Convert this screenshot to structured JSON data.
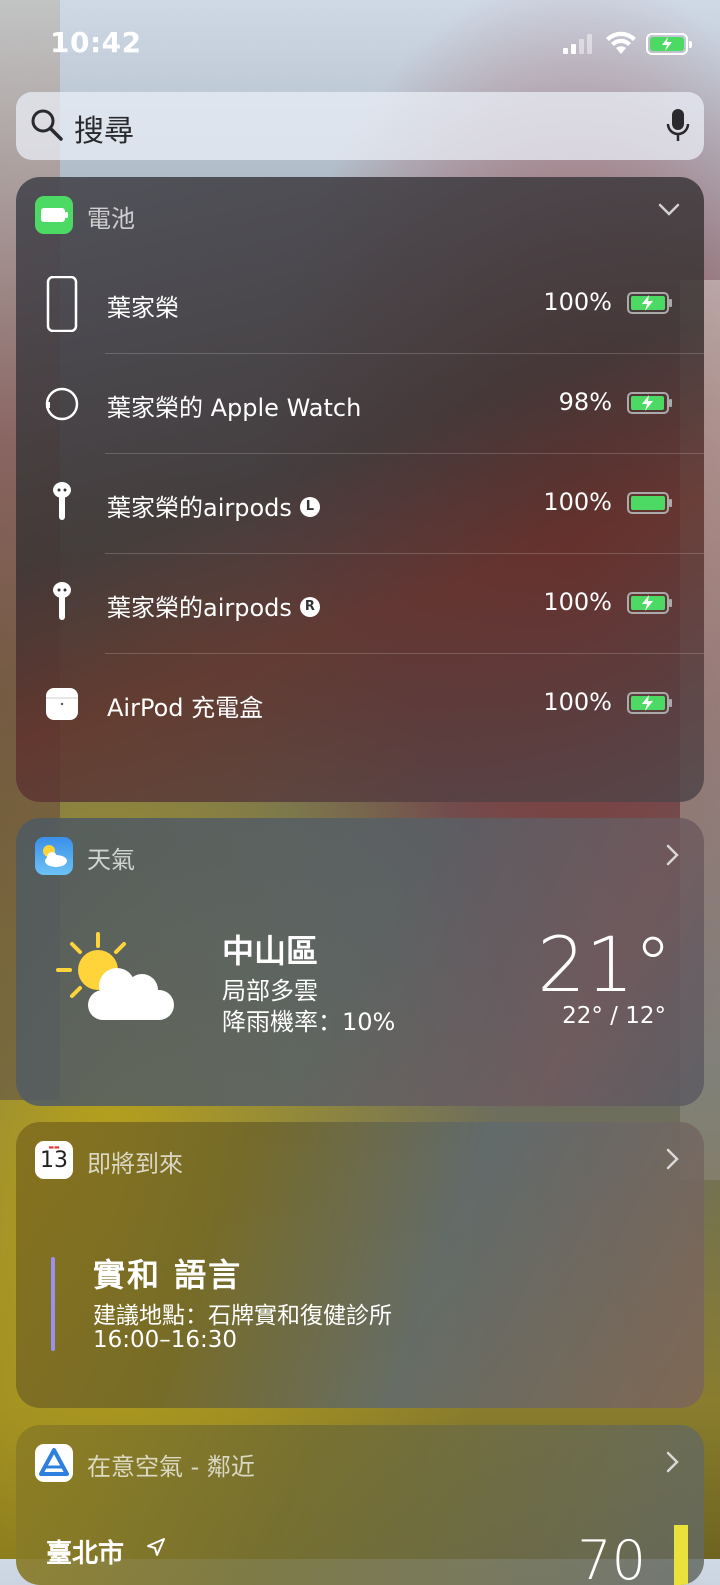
{
  "status": {
    "time": "10:42"
  },
  "search": {
    "placeholder": "搜尋"
  },
  "battery_widget": {
    "title": "電池",
    "devices": [
      {
        "name": "葉家榮",
        "percent": "100%",
        "level": 1.0,
        "charging": true,
        "icon": "iphone-icon"
      },
      {
        "name": "葉家榮的 Apple Watch",
        "percent": "98%",
        "level": 0.98,
        "charging": true,
        "icon": "apple-watch-icon"
      },
      {
        "name": "葉家榮的airpods",
        "side": "L",
        "percent": "100%",
        "level": 1.0,
        "charging": false,
        "icon": "airpod-left-icon"
      },
      {
        "name": "葉家榮的airpods",
        "side": "R",
        "percent": "100%",
        "level": 1.0,
        "charging": true,
        "icon": "airpod-right-icon"
      },
      {
        "name": "AirPod 充電盒",
        "percent": "100%",
        "level": 1.0,
        "charging": true,
        "icon": "airpod-case-icon"
      }
    ]
  },
  "weather_widget": {
    "title": "天氣",
    "location": "中山區",
    "condition": "局部多雲",
    "rain_chance": "降雨機率：10%",
    "temperature": "21°",
    "range": "22° / 12°",
    "icon": "partly-cloudy-icon"
  },
  "calendar_widget": {
    "title": "即將到來",
    "icon_day": "13",
    "event_title": "實和 語言",
    "event_location": "建議地點：石牌實和復健診所",
    "event_time": "16:00–16:30",
    "event_color": "#9b8ff0"
  },
  "air_widget": {
    "title": "在意空氣 - 鄰近",
    "city": "臺北市",
    "value": "70"
  },
  "colors": {
    "battery_green": "#4cd964",
    "air_indicator": "#e8e23a"
  }
}
